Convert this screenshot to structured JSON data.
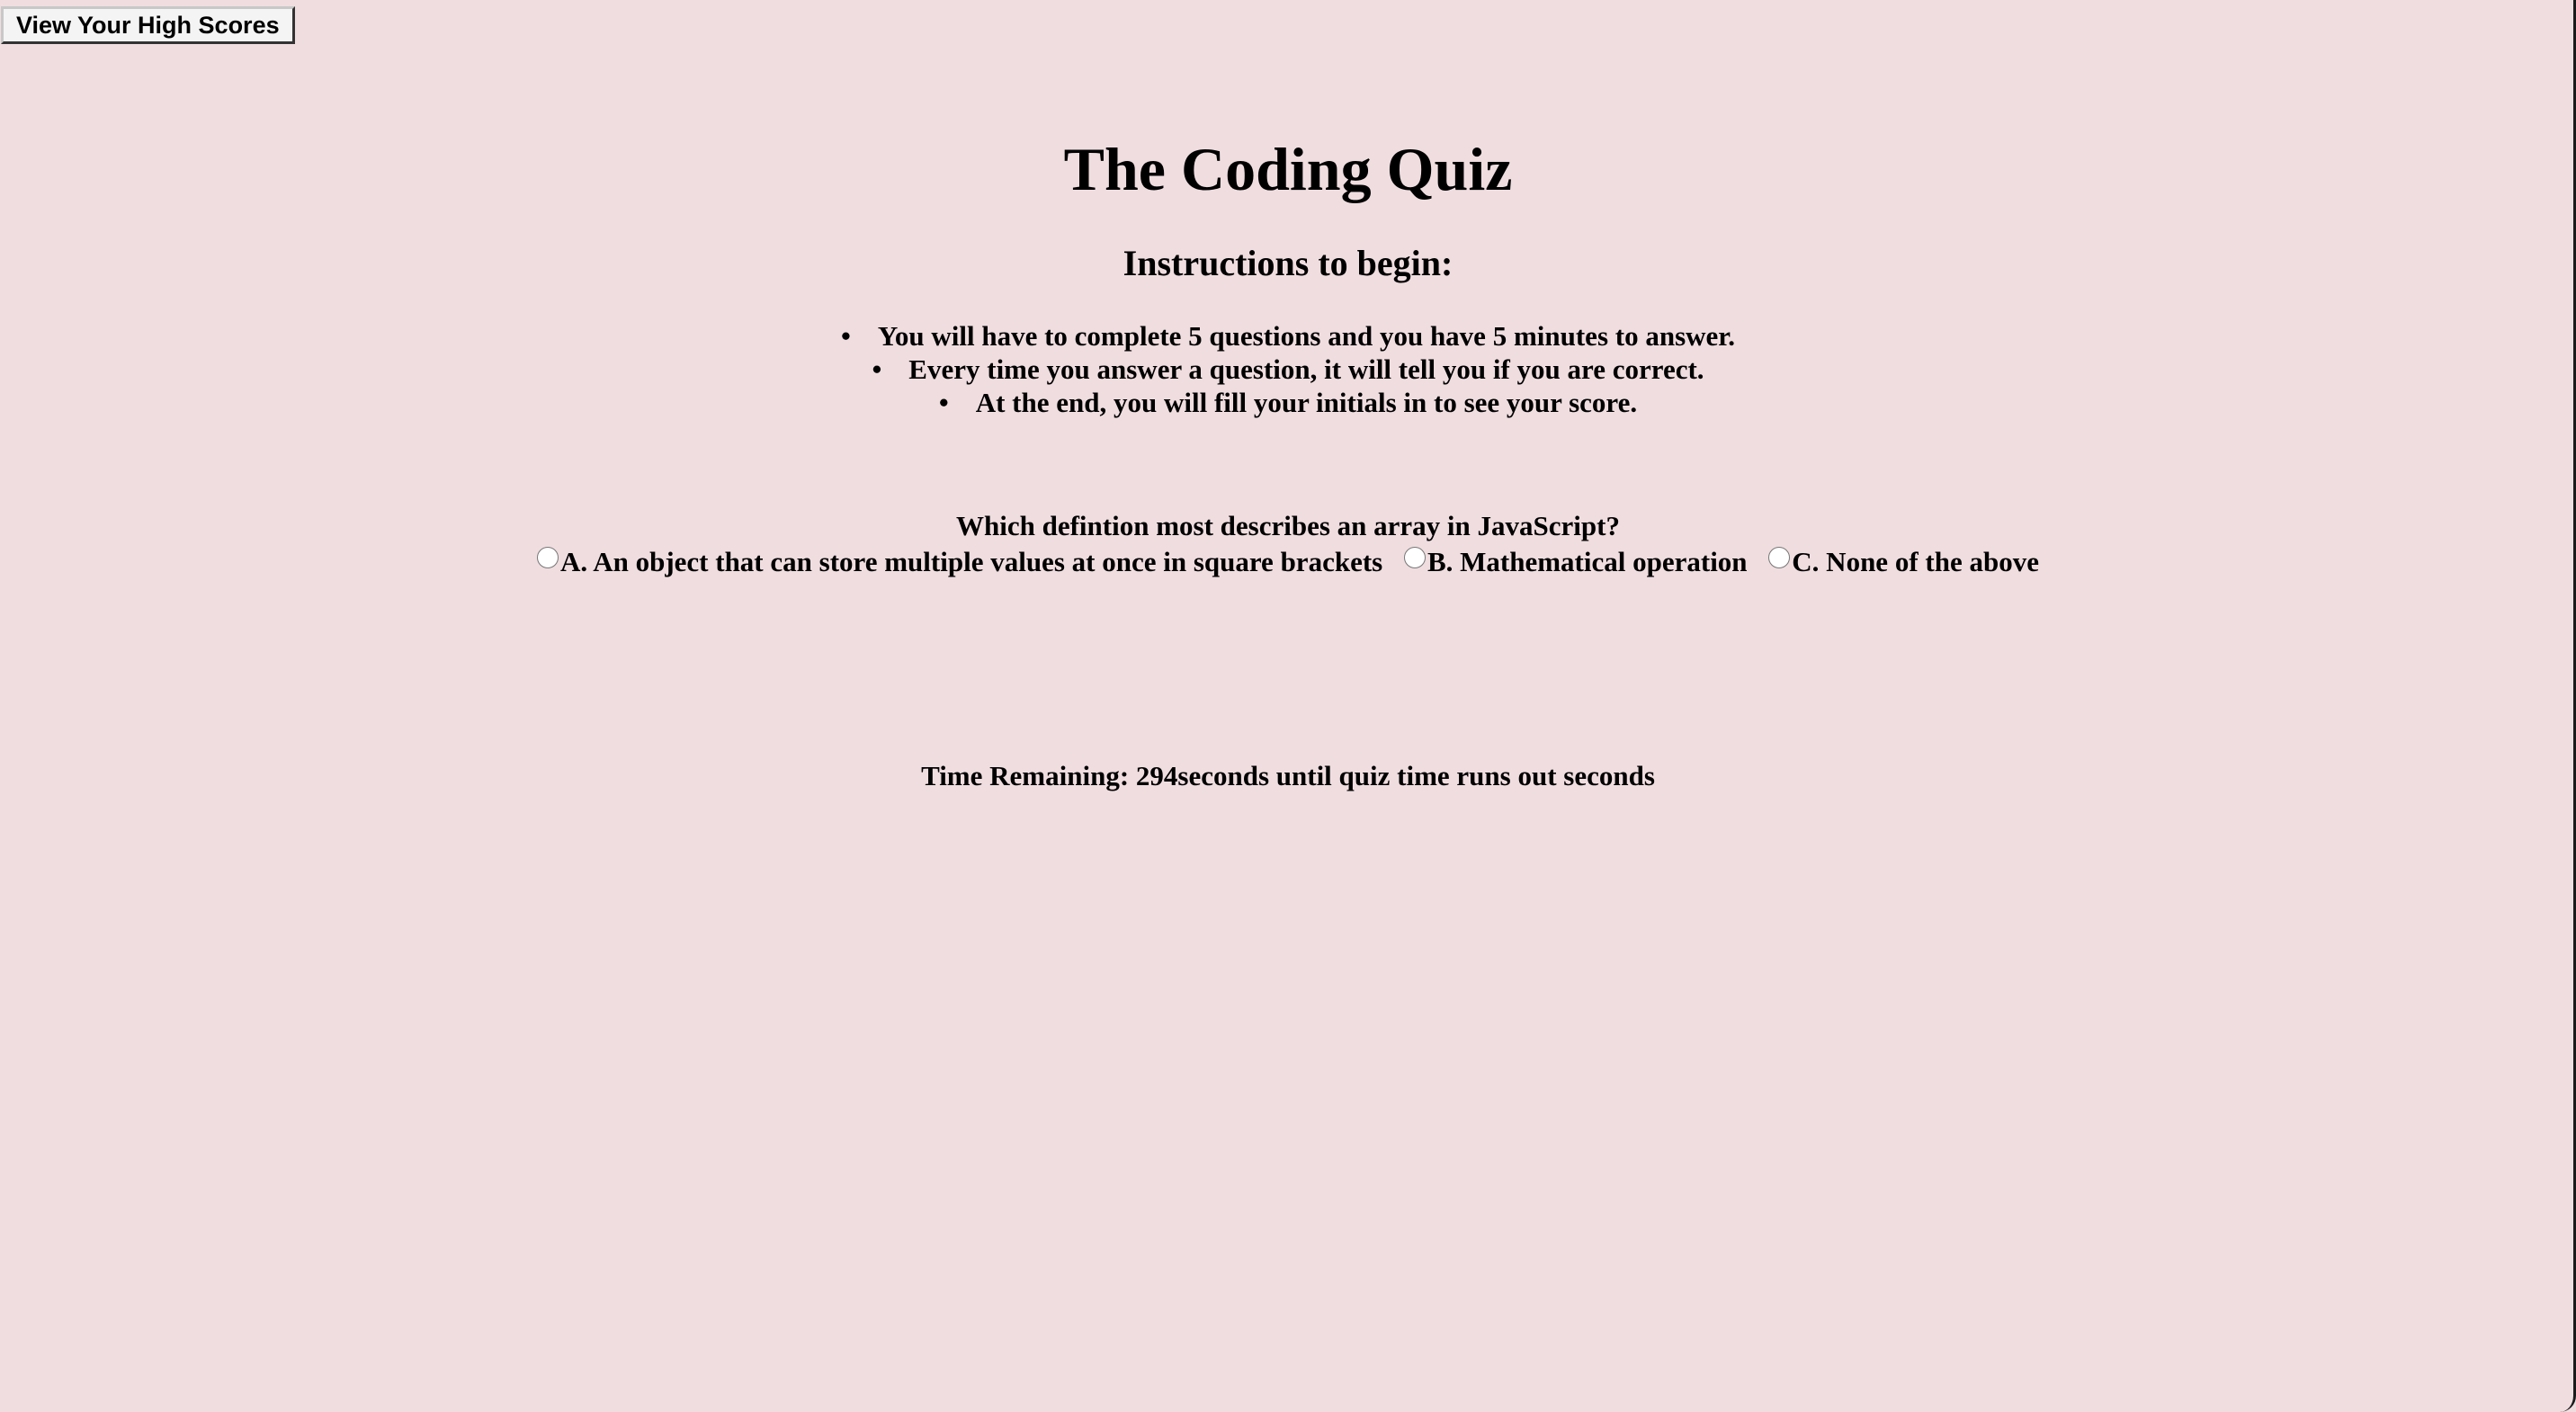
{
  "header": {
    "high_scores_label": "View Your High Scores"
  },
  "main": {
    "title": "The Coding Quiz",
    "subtitle": "Instructions to begin:",
    "instructions": [
      "You will have to complete 5 questions and you have 5 minutes to answer.",
      "Every time you answer a question, it will tell you if you are correct.",
      "At the end, you will fill your initials in to see your score."
    ],
    "bullet": "•"
  },
  "quiz": {
    "question": "Which defintion most describes an array in JavaScript?",
    "choices": [
      {
        "label": "A. An object that can store multiple values at once in square brackets",
        "selected": false
      },
      {
        "label": "B. Mathematical operation",
        "selected": false
      },
      {
        "label": "C. None of the above",
        "selected": false
      }
    ]
  },
  "timer": {
    "prefix": "Time Remaining: ",
    "value": "294",
    "suffix": "seconds until quiz time runs out seconds"
  },
  "colors": {
    "background": "#f0dde0",
    "text": "#000000"
  }
}
